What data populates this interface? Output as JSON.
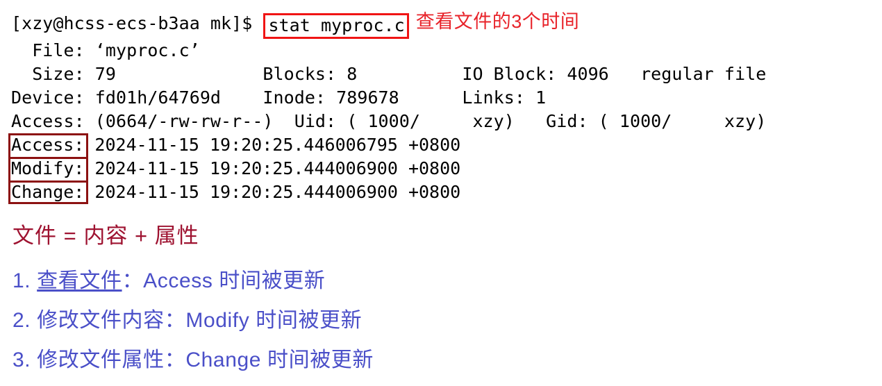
{
  "terminal": {
    "prompt": "[xzy@hcss-ecs-b3aa mk]$ ",
    "command": "stat myproc.c",
    "command_annotation": "查看文件的3个时间",
    "lines": [
      "  File: ‘myproc.c’",
      "  Size: 79              Blocks: 8          IO Block: 4096   regular file",
      "Device: fd01h/64769d    Inode: 789678      Links: 1",
      "Access: (0664/-rw-rw-r--)  Uid: ( 1000/     xzy)   Gid: ( 1000/     xzy)"
    ],
    "time_lines": [
      "Access: 2024-11-15 19:20:25.446006795 +0800",
      "Modify: 2024-11-15 19:20:25.444006900 +0800",
      "Change: 2024-11-15 19:20:25.444006900 +0800"
    ]
  },
  "notes": {
    "headline": "文件 = 内容 + 属性",
    "list": [
      {
        "number": "1. ",
        "action": "查看文件",
        "rest": "：Access 时间被更新",
        "underline": true
      },
      {
        "number": "2. ",
        "action": "修改文件内容",
        "rest": "：Modify 时间被更新",
        "underline": false
      },
      {
        "number": "3. ",
        "action": "修改文件属性",
        "rest": "：Change 时间被更新",
        "underline": false
      }
    ]
  },
  "colors": {
    "command_box_border": "#f01414",
    "command_annotation": "#e8232a",
    "label_box_border": "#8c1111",
    "headline": "#9e1230",
    "list_text": "#4a4fc8",
    "terminal_text": "#000000",
    "background": "#ffffff"
  }
}
